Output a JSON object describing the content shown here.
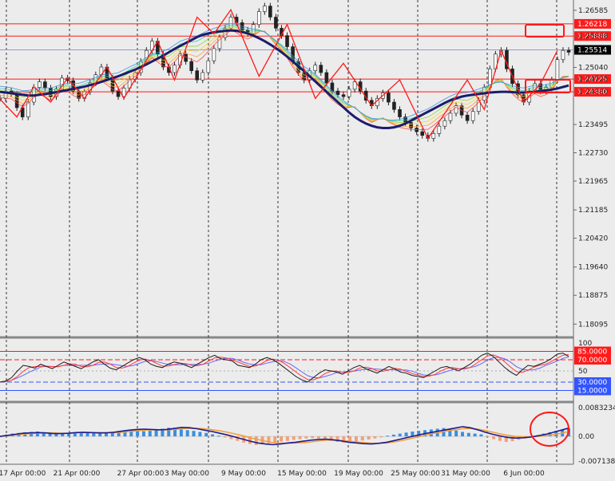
{
  "chart_data": {
    "type": "line",
    "x_labels": [
      "17 Apr 00:00",
      "21 Apr 00:00",
      "27 Apr 00:00",
      "3 May 00:00",
      "9 May 00:00",
      "15 May 00:00",
      "19 May 00:00",
      "25 May 00:00",
      "31 May 00:00",
      "6 Jun 00:00"
    ],
    "price_ticks": [
      "1.26585",
      "1.25888",
      "1.25040",
      "1.24725",
      "1.24380",
      "1.23495",
      "1.22730",
      "1.21965",
      "1.21185",
      "1.20420",
      "1.19640",
      "1.18875",
      "1.18095"
    ],
    "price_ylim": [
      1.178,
      1.2682
    ],
    "horizontal_levels": [
      {
        "value": 1.26218,
        "label": "1.26218",
        "color": "#ff1a1a"
      },
      {
        "value": 1.25888,
        "label": "1.25888",
        "color": "#ff1a1a"
      },
      {
        "value": 1.25514,
        "label": "1.25514",
        "color": "#000000"
      },
      {
        "value": 1.24725,
        "label": "1.24725",
        "color": "#ff1a1a"
      },
      {
        "value": 1.2438,
        "label": "1.24380",
        "color": "#ff1a1a"
      }
    ],
    "price_series": [
      1.242,
      1.244,
      1.2432,
      1.2395,
      1.237,
      1.241,
      1.245,
      1.2465,
      1.2448,
      1.2425,
      1.2445,
      1.2475,
      1.2468,
      1.244,
      1.242,
      1.2438,
      1.2462,
      1.2484,
      1.2505,
      1.2475,
      1.244,
      1.2425,
      1.2448,
      1.2472,
      1.249,
      1.252,
      1.255,
      1.2575,
      1.254,
      1.2505,
      1.249,
      1.251,
      1.254,
      1.252,
      1.2495,
      1.247,
      1.249,
      1.2522,
      1.2555,
      1.2585,
      1.261,
      1.264,
      1.2625,
      1.2605,
      1.2595,
      1.262,
      1.2655,
      1.267,
      1.264,
      1.261,
      1.259,
      1.256,
      1.252,
      1.249,
      1.247,
      1.2495,
      1.251,
      1.249,
      1.2462,
      1.244,
      1.243,
      1.2425,
      1.2445,
      1.2465,
      1.244,
      1.2415,
      1.24,
      1.242,
      1.2435,
      1.241,
      1.239,
      1.237,
      1.2355,
      1.234,
      1.233,
      1.232,
      1.2312,
      1.2325,
      1.2345,
      1.236,
      1.238,
      1.24,
      1.2375,
      1.236,
      1.2385,
      1.2415,
      1.245,
      1.25,
      1.254,
      1.255,
      1.25,
      1.246,
      1.243,
      1.241,
      1.244,
      1.246,
      1.244,
      1.245,
      1.247,
      1.2525,
      1.255,
      1.2545
    ],
    "ma_series": [
      1.2438,
      1.2436,
      1.2434,
      1.2432,
      1.243,
      1.2428,
      1.2428,
      1.243,
      1.2432,
      1.2434,
      1.2437,
      1.244,
      1.2443,
      1.2446,
      1.2449,
      1.2452,
      1.2456,
      1.246,
      1.2465,
      1.247,
      1.2475,
      1.248,
      1.2486,
      1.2492,
      1.2498,
      1.2505,
      1.2512,
      1.252,
      1.2528,
      1.2536,
      1.2545,
      1.2554,
      1.2562,
      1.257,
      1.2578,
      1.2586,
      1.2592,
      1.2596,
      1.2599,
      1.2601,
      1.2603,
      1.2604,
      1.2603,
      1.26,
      1.2596,
      1.259,
      1.2583,
      1.2575,
      1.2566,
      1.2556,
      1.2545,
      1.2533,
      1.252,
      1.2507,
      1.2494,
      1.248,
      1.2466,
      1.2452,
      1.2438,
      1.2424,
      1.241,
      1.2396,
      1.2382,
      1.237,
      1.236,
      1.2352,
      1.2346,
      1.2342,
      1.234,
      1.234,
      1.2342,
      1.2346,
      1.2352,
      1.236,
      1.2368,
      1.2376,
      1.2384,
      1.2392,
      1.24,
      1.2408,
      1.2415,
      1.242,
      1.2425,
      1.2428,
      1.243,
      1.2432,
      1.2434,
      1.2436,
      1.2437,
      1.2438,
      1.2438,
      1.2437,
      1.2436,
      1.2436,
      1.2437,
      1.2438,
      1.244,
      1.2442,
      1.2444,
      1.2447,
      1.2451,
      1.2455
    ],
    "zigzag_points": [
      [
        0,
        1.2418
      ],
      [
        3,
        1.237
      ],
      [
        6,
        1.2452
      ],
      [
        9,
        1.241
      ],
      [
        12,
        1.2475
      ],
      [
        15,
        1.242
      ],
      [
        19,
        1.2505
      ],
      [
        22,
        1.242
      ],
      [
        28,
        1.2575
      ],
      [
        31,
        1.247
      ],
      [
        35,
        1.264
      ],
      [
        38,
        1.2595
      ],
      [
        41,
        1.266
      ],
      [
        46,
        1.248
      ],
      [
        51,
        1.262
      ],
      [
        56,
        1.242
      ],
      [
        61,
        1.2515
      ],
      [
        66,
        1.24
      ],
      [
        71,
        1.247
      ],
      [
        76,
        1.2312
      ],
      [
        83,
        1.247
      ],
      [
        86,
        1.239
      ],
      [
        89,
        1.255
      ],
      [
        93,
        1.241
      ],
      [
        96,
        1.246
      ],
      [
        99,
        1.255
      ]
    ],
    "rsi": {
      "ylim": [
        0,
        100
      ],
      "tick_label_top": "100",
      "tick_label_mid": "50",
      "levels": [
        {
          "value": 85,
          "label": "85.0000",
          "color": "#ff1a1a"
        },
        {
          "value": 70,
          "label": "70.0000",
          "color": "#ff1a1a"
        },
        {
          "value": 30,
          "label": "30.0000",
          "color": "#3355ff"
        },
        {
          "value": 15,
          "label": "15.0000",
          "color": "#3355ff"
        }
      ],
      "values": [
        30,
        32,
        38,
        50,
        60,
        58,
        55,
        62,
        58,
        54,
        60,
        66,
        62,
        58,
        54,
        60,
        66,
        70,
        62,
        55,
        52,
        58,
        64,
        70,
        74,
        70,
        62,
        58,
        56,
        62,
        66,
        64,
        60,
        56,
        62,
        68,
        74,
        78,
        72,
        70,
        68,
        60,
        58,
        56,
        62,
        70,
        74,
        70,
        64,
        56,
        48,
        40,
        34,
        30,
        38,
        46,
        52,
        50,
        48,
        44,
        50,
        56,
        60,
        54,
        50,
        46,
        52,
        58,
        54,
        48,
        46,
        42,
        40,
        38,
        44,
        50,
        56,
        58,
        54,
        50,
        56,
        62,
        70,
        78,
        82,
        76,
        66,
        56,
        48,
        42,
        52,
        60,
        58,
        62,
        66,
        72,
        80,
        82,
        76
      ]
    },
    "macd": {
      "tick_labels": [
        "0.0083234",
        "0.00",
        "-0.0071383"
      ],
      "ylim": [
        -0.0071383,
        0.0083234
      ],
      "hist": [
        0.0002,
        0.0005,
        0.0008,
        0.001,
        0.0012,
        0.0013,
        0.0014,
        0.0012,
        0.001,
        0.0008,
        0.0007,
        0.0008,
        0.001,
        0.0012,
        0.0011,
        0.0009,
        0.0008,
        0.0009,
        0.0011,
        0.0014,
        0.0016,
        0.0018,
        0.0017,
        0.0015,
        0.0016,
        0.0019,
        0.0022,
        0.0025,
        0.0023,
        0.002,
        0.0018,
        0.0016,
        0.0013,
        0.001,
        0.0006,
        0.0002,
        -0.0003,
        -0.0008,
        -0.0013,
        -0.0018,
        -0.0022,
        -0.0025,
        -0.0023,
        -0.002,
        -0.0018,
        -0.0015,
        -0.0013,
        -0.001,
        -0.0008,
        -0.0006,
        -0.0005,
        -0.0007,
        -0.001,
        -0.0013,
        -0.0016,
        -0.0018,
        -0.0017,
        -0.0015,
        -0.0012,
        -0.0009,
        -0.0006,
        -0.0003,
        0.0002,
        0.0005,
        0.0008,
        0.0011,
        0.0014,
        0.0016,
        0.0018,
        0.002,
        0.0022,
        0.0024,
        0.0021,
        0.0017,
        0.0013,
        0.001,
        0.0008,
        0.0006,
        -0.0002,
        -0.0008,
        -0.0013,
        -0.0016,
        -0.0014,
        -0.001,
        -0.0006,
        -0.0002,
        0.0003,
        0.0008,
        0.0012,
        0.0016,
        0.002,
        0.0024
      ],
      "line": [
        0.0,
        0.0003,
        0.0006,
        0.0009,
        0.001,
        0.0011,
        0.001,
        0.0008,
        0.0008,
        0.0009,
        0.0011,
        0.0012,
        0.0011,
        0.001,
        0.001,
        0.0012,
        0.0015,
        0.0018,
        0.002,
        0.0021,
        0.002,
        0.0019,
        0.002,
        0.0023,
        0.0026,
        0.0025,
        0.0022,
        0.0018,
        0.0014,
        0.0009,
        0.0004,
        -0.0002,
        -0.0008,
        -0.0014,
        -0.0019,
        -0.0022,
        -0.0024,
        -0.0022,
        -0.0019,
        -0.0017,
        -0.0014,
        -0.0011,
        -0.0009,
        -0.0008,
        -0.001,
        -0.0013,
        -0.0017,
        -0.0019,
        -0.0021,
        -0.0022,
        -0.002,
        -0.0017,
        -0.0012,
        -0.0007,
        -0.0002,
        0.0003,
        0.0008,
        0.0012,
        0.0016,
        0.002,
        0.0024,
        0.0028,
        0.0025,
        0.0019,
        0.0012,
        0.0006,
        0.0001,
        -0.0003,
        -0.0005,
        -0.0004,
        -0.0002,
        0.0002,
        0.0006,
        0.0012,
        0.0018,
        0.0024
      ],
      "signal": [
        0.0,
        0.0002,
        0.0004,
        0.0006,
        0.0008,
        0.0009,
        0.001,
        0.001,
        0.0009,
        0.0009,
        0.001,
        0.0011,
        0.0011,
        0.0011,
        0.0011,
        0.0011,
        0.0012,
        0.0014,
        0.0016,
        0.0018,
        0.0019,
        0.0019,
        0.0019,
        0.002,
        0.0022,
        0.0023,
        0.0023,
        0.0022,
        0.0019,
        0.0016,
        0.0012,
        0.0007,
        0.0002,
        -0.0004,
        -0.0009,
        -0.0014,
        -0.0018,
        -0.002,
        -0.002,
        -0.0019,
        -0.0018,
        -0.0016,
        -0.0013,
        -0.0011,
        -0.0011,
        -0.0012,
        -0.0014,
        -0.0016,
        -0.0018,
        -0.002,
        -0.002,
        -0.0019,
        -0.0016,
        -0.0012,
        -0.0007,
        -0.0002,
        0.0003,
        0.0008,
        0.0012,
        0.0016,
        0.0019,
        0.0022,
        0.0023,
        0.0021,
        0.0017,
        0.0012,
        0.0007,
        0.0003,
        0.0,
        -0.0001,
        -0.0001,
        0.0,
        0.0002,
        0.0005,
        0.0009,
        0.0014
      ]
    },
    "colors": {
      "background": "#ececec",
      "price_line": "#1a1a1a",
      "ma": "#1c1c6e",
      "zigzag": "#ff1a1a",
      "rsi_line": "#1a1a1a",
      "rsi_line2": "#ff3b3b",
      "rsi_line3": "#6666ff",
      "hist_pos": "#3a8fe0",
      "hist_neg": "#f3a07a",
      "macd_line": "#1c1c8e",
      "macd_signal": "#f0a040",
      "highlight": "#ff1a1a",
      "level_label_text": "#ffffff"
    }
  }
}
